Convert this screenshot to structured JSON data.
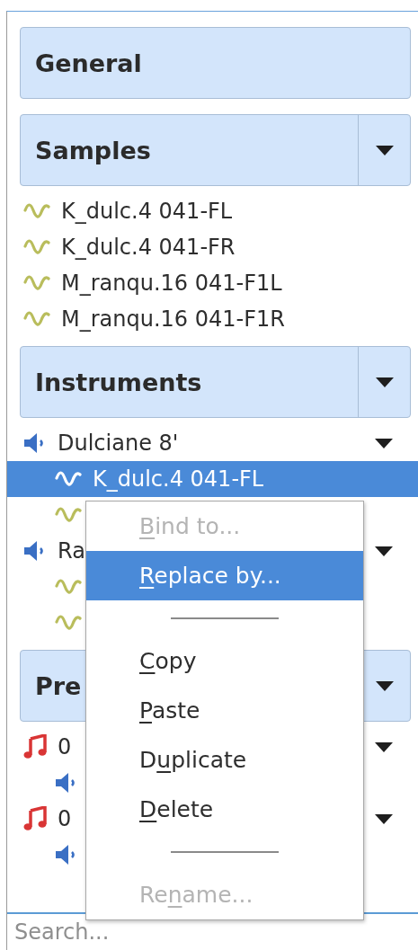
{
  "sections": [
    {
      "title": "General",
      "has_menu": false
    },
    {
      "title": "Samples",
      "has_menu": true,
      "items": [
        {
          "kind": "sample",
          "label": "K_dulc.4 041-FL",
          "selected": false,
          "has_menu": false
        },
        {
          "kind": "sample",
          "label": "K_dulc.4 041-FR",
          "selected": false,
          "has_menu": false
        },
        {
          "kind": "sample",
          "label": "M_ranqu.16 041-F1L",
          "selected": false,
          "has_menu": false
        },
        {
          "kind": "sample",
          "label": "M_ranqu.16 041-F1R",
          "selected": false,
          "has_menu": false
        }
      ]
    },
    {
      "title": "Instruments",
      "has_menu": true,
      "items": [
        {
          "kind": "instrument",
          "label": "Dulciane 8'",
          "selected": false,
          "has_menu": true,
          "children": [
            {
              "kind": "sample",
              "label": "K_dulc.4 041-FL",
              "selected": true,
              "has_menu": false
            },
            {
              "kind": "sample",
              "selected": false,
              "has_menu": false
            }
          ]
        },
        {
          "kind": "instrument",
          "label": "Ra",
          "selected": false,
          "has_menu": true,
          "children": [
            {
              "kind": "sample",
              "selected": false,
              "has_menu": false
            },
            {
              "kind": "sample",
              "selected": false,
              "has_menu": false
            }
          ]
        }
      ]
    },
    {
      "title": "Pre",
      "has_menu": true,
      "items": [
        {
          "kind": "preset",
          "label": "0",
          "selected": false,
          "has_menu": true,
          "children": [
            {
              "kind": "instrument",
              "selected": false,
              "has_menu": false
            }
          ]
        },
        {
          "kind": "preset",
          "label": "0",
          "selected": false,
          "has_menu": true,
          "children": [
            {
              "kind": "instrument",
              "selected": false,
              "has_menu": false
            }
          ]
        }
      ]
    }
  ],
  "context_menu": {
    "items": [
      {
        "kind": "action",
        "key": "B",
        "post": "ind to...",
        "disabled": true,
        "selected": false
      },
      {
        "kind": "action",
        "key": "R",
        "post": "eplace by...",
        "disabled": false,
        "selected": true
      },
      {
        "kind": "separator"
      },
      {
        "kind": "action",
        "key": "C",
        "post": "opy",
        "disabled": false,
        "selected": false
      },
      {
        "kind": "action",
        "key": "P",
        "post": "aste",
        "disabled": false,
        "selected": false
      },
      {
        "kind": "action",
        "pre": "D",
        "key": "u",
        "post": "plicate",
        "disabled": false,
        "selected": false
      },
      {
        "kind": "action",
        "key": "D",
        "post": "elete",
        "disabled": false,
        "selected": false
      },
      {
        "kind": "separator"
      },
      {
        "kind": "action",
        "pre": "Re",
        "key": "n",
        "post": "ame...",
        "disabled": true,
        "selected": false
      }
    ]
  },
  "search": {
    "placeholder": "Search..."
  }
}
